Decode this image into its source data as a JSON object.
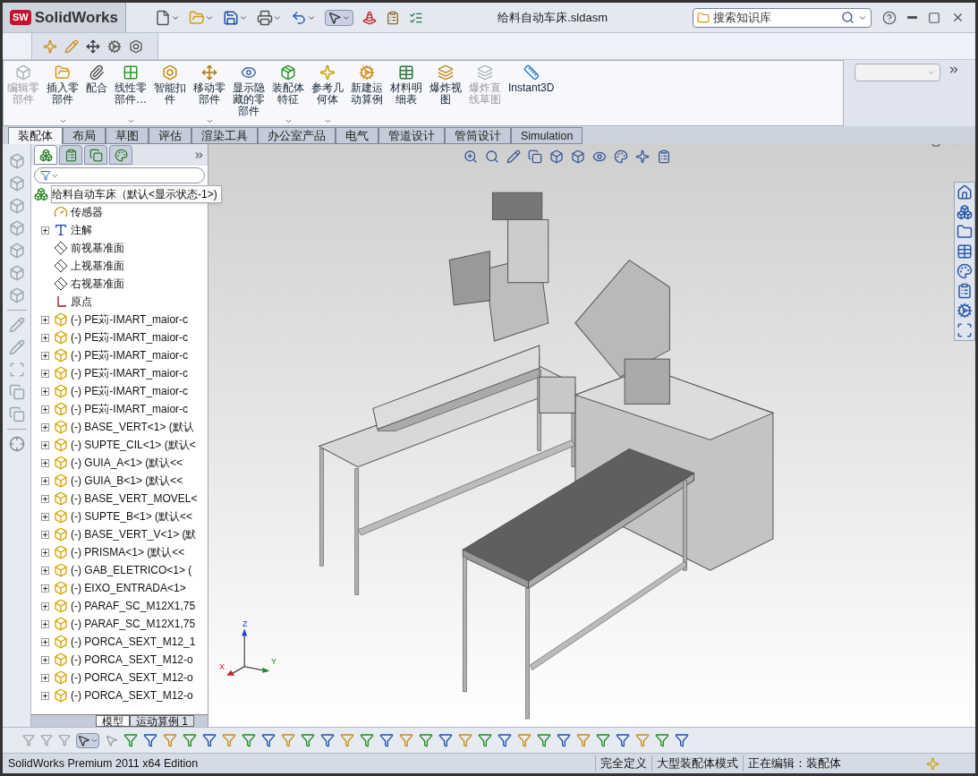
{
  "logo": {
    "badge": "SW",
    "name": "SolidWorks"
  },
  "window": {
    "title": "给料自动车床.sldasm"
  },
  "search": {
    "placeholder": "搜索知识库"
  },
  "ribbon": [
    {
      "label": [
        "编辑零",
        "部件"
      ],
      "disabled": true,
      "has_menu": false
    },
    {
      "label": [
        "插入零",
        "部件"
      ],
      "disabled": false,
      "has_menu": true
    },
    {
      "label": [
        "配合"
      ],
      "disabled": false,
      "has_menu": false
    },
    {
      "label": [
        "线性零",
        "部件…"
      ],
      "disabled": false,
      "has_menu": true
    },
    {
      "label": [
        "智能扣",
        "件"
      ],
      "disabled": false,
      "has_menu": false
    },
    {
      "label": [
        "移动零",
        "部件"
      ],
      "disabled": false,
      "has_menu": true
    },
    {
      "label": [
        "显示隐",
        "藏的零",
        "部件"
      ],
      "disabled": false,
      "has_menu": false
    },
    {
      "label": [
        "装配体",
        "特征"
      ],
      "disabled": false,
      "has_menu": true
    },
    {
      "label": [
        "参考几",
        "何体"
      ],
      "disabled": false,
      "has_menu": true
    },
    {
      "label": [
        "新建运",
        "动算例"
      ],
      "disabled": false,
      "has_menu": false
    },
    {
      "label": [
        "材料明",
        "细表"
      ],
      "disabled": false,
      "has_menu": false
    },
    {
      "label": [
        "爆炸视",
        "图"
      ],
      "disabled": false,
      "has_menu": false
    },
    {
      "label": [
        "爆炸直",
        "线草图"
      ],
      "disabled": true,
      "has_menu": false
    },
    {
      "label": [
        "Instant3D"
      ],
      "disabled": false,
      "has_menu": false
    }
  ],
  "command_tabs": [
    {
      "label": "装配体",
      "selected": true
    },
    {
      "label": "布局",
      "selected": false
    },
    {
      "label": "草图",
      "selected": false
    },
    {
      "label": "评估",
      "selected": false
    },
    {
      "label": "渲染工具",
      "selected": false
    },
    {
      "label": "办公室产品",
      "selected": false
    },
    {
      "label": "电气",
      "selected": false
    },
    {
      "label": "管道设计",
      "selected": false
    },
    {
      "label": "管筒设计",
      "selected": false
    },
    {
      "label": "Simulation",
      "selected": false
    }
  ],
  "panel_tabs": [
    {
      "selected": true
    },
    {
      "selected": false
    },
    {
      "selected": false
    },
    {
      "selected": false
    }
  ],
  "tree": {
    "label": "给料自动车床（默认<显示状态-1>)",
    "kind": "assembly",
    "children": [
      {
        "label": "传感器",
        "kind": "sensor"
      },
      {
        "label": "注解",
        "kind": "annotation",
        "expanded": false
      },
      {
        "label": "前视基准面",
        "kind": "plane"
      },
      {
        "label": "上视基准面",
        "kind": "plane"
      },
      {
        "label": "右视基准面",
        "kind": "plane"
      },
      {
        "label": "原点",
        "kind": "origin"
      },
      {
        "label": "(-) PE苅-IMART_maior-c",
        "kind": "part",
        "expanded": false
      },
      {
        "label": "(-) PE苅-IMART_maior-c",
        "kind": "part",
        "expanded": false
      },
      {
        "label": "(-) PE苅-IMART_maior-c",
        "kind": "part",
        "expanded": false
      },
      {
        "label": "(-) PE苅-IMART_maior-c",
        "kind": "part",
        "expanded": false
      },
      {
        "label": "(-) PE苅-IMART_maior-c",
        "kind": "part",
        "expanded": false
      },
      {
        "label": "(-) PE苅-IMART_maior-c",
        "kind": "part",
        "expanded": false
      },
      {
        "label": "(-) BASE_VERT<1> (默认",
        "kind": "part",
        "expanded": false
      },
      {
        "label": "(-) SUPTE_CIL<1> (默认<",
        "kind": "part",
        "expanded": false
      },
      {
        "label": "(-) GUIA_A<1> (默认<<",
        "kind": "part",
        "expanded": false
      },
      {
        "label": "(-) GUIA_B<1> (默认<<",
        "kind": "part",
        "expanded": false
      },
      {
        "label": "(-) BASE_VERT_MOVEL<",
        "kind": "part",
        "expanded": false
      },
      {
        "label": "(-) SUPTE_B<1> (默认<<",
        "kind": "part",
        "expanded": false
      },
      {
        "label": "(-) BASE_VERT_V<1> (默",
        "kind": "part",
        "expanded": false
      },
      {
        "label": "(-) PRISMA<1> (默认<<",
        "kind": "part",
        "expanded": false
      },
      {
        "label": "(-) GAB_ELETRICO<1> (",
        "kind": "part",
        "expanded": false
      },
      {
        "label": "(-) EIXO_ENTRADA<1>",
        "kind": "part",
        "expanded": false
      },
      {
        "label": "(-) PARAF_SC_M12X1,75",
        "kind": "part",
        "expanded": false
      },
      {
        "label": "(-) PARAF_SC_M12X1,75",
        "kind": "part",
        "expanded": false
      },
      {
        "label": "(-) PORCA_SEXT_M12_1",
        "kind": "part",
        "expanded": false
      },
      {
        "label": "(-) PORCA_SEXT_M12-o",
        "kind": "part",
        "expanded": false
      },
      {
        "label": "(-) PORCA_SEXT_M12-o",
        "kind": "part",
        "expanded": false
      },
      {
        "label": "(-) PORCA_SEXT_M12-o",
        "kind": "part",
        "expanded": false
      }
    ]
  },
  "bottom_tabs": [
    {
      "label": "模型",
      "selected": true
    },
    {
      "label": "运动算例 1",
      "selected": false
    }
  ],
  "triad": {
    "x": "X",
    "y": "Y",
    "z": "Z"
  },
  "status_bar": {
    "product": "SolidWorks Premium 2011 x64 Edition",
    "items": [
      "完全定义",
      "大型装配体模式",
      "正在编辑：装配体"
    ]
  }
}
